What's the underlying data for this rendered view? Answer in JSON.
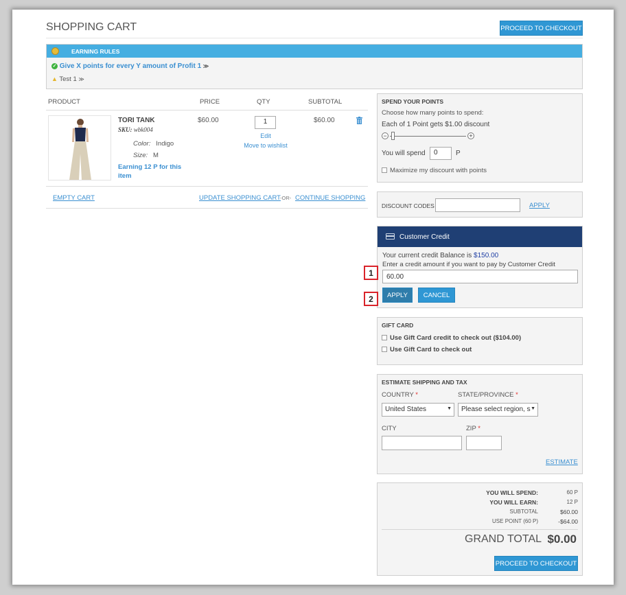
{
  "page": {
    "title": "SHOPPING CART",
    "proceed_top": "PROCEED TO CHECKOUT",
    "proceed_bottom": "PROCEED TO CHECKOUT"
  },
  "earning_rules": {
    "header": "EARNING RULES",
    "rules": [
      {
        "text": "Give X points for every Y amount of Profit 1",
        "status": "ok"
      },
      {
        "text": "Test 1",
        "status": "warning"
      }
    ]
  },
  "cart_table": {
    "columns": [
      "PRODUCT",
      "PRICE",
      "QTY",
      "SUBTOTAL"
    ],
    "items": [
      {
        "name": "TORI TANK",
        "sku_label": "SKU:",
        "sku": "wbk004",
        "color_label": "Color:",
        "color": "Indigo",
        "size_label": "Size:",
        "size": "M",
        "earning": "Earning 12 P for this item",
        "price": "$60.00",
        "qty": "1",
        "edit": "Edit",
        "wishlist": "Move to wishlist",
        "subtotal": "$60.00"
      }
    ],
    "empty_cart": "EMPTY CART",
    "update_cart": "UPDATE SHOPPING CART",
    "or": "-OR-",
    "continue": "CONTINUE SHOPPING"
  },
  "spend_points": {
    "header": "SPEND YOUR POINTS",
    "instruction": "Choose how many points to spend:",
    "rate": "Each of 1 Point gets $1.00 discount",
    "slider_level": 0,
    "spend_label": "You will spend",
    "spend_value": "0",
    "unit": "P",
    "maximize": "Maximize my discount with points"
  },
  "discount": {
    "label": "DISCOUNT CODES",
    "value": "",
    "apply": "APPLY"
  },
  "customer_credit": {
    "header": "Customer Credit",
    "balance_text": "Your current credit Balance is",
    "balance": "$150.00",
    "instruction": "Enter a credit amount if you want to pay by Customer Credit",
    "amount": "60.00",
    "apply": "APPLY",
    "cancel": "CANCEL",
    "marker1": "1",
    "marker2": "2"
  },
  "gift_card": {
    "header": "GIFT CARD",
    "option1": "Use Gift Card credit to check out ($104.00)",
    "option2": "Use Gift Card to check out"
  },
  "shipping": {
    "header": "ESTIMATE SHIPPING AND TAX",
    "country_label": "COUNTRY",
    "country": "United States",
    "state_label": "STATE/PROVINCE",
    "state": "Please select region, s",
    "city_label": "CITY",
    "city": "",
    "zip_label": "ZIP",
    "zip": "",
    "required": "*",
    "estimate": "ESTIMATE"
  },
  "totals": {
    "rows": [
      {
        "label": "YOU WILL SPEND:",
        "value": "60 P"
      },
      {
        "label": "YOU WILL EARN:",
        "value": "12 P"
      },
      {
        "label": "SUBTOTAL",
        "value": "$60.00"
      },
      {
        "label": "USE POINT (60 P)",
        "value": "-$64.00"
      }
    ],
    "grand_label": "GRAND TOTAL",
    "grand_value": "$0.00"
  },
  "colors": {
    "accent": "#2f97d4",
    "credit_header": "#1f3f74",
    "rules_header": "#45aee1",
    "marker": "#d9232a"
  }
}
